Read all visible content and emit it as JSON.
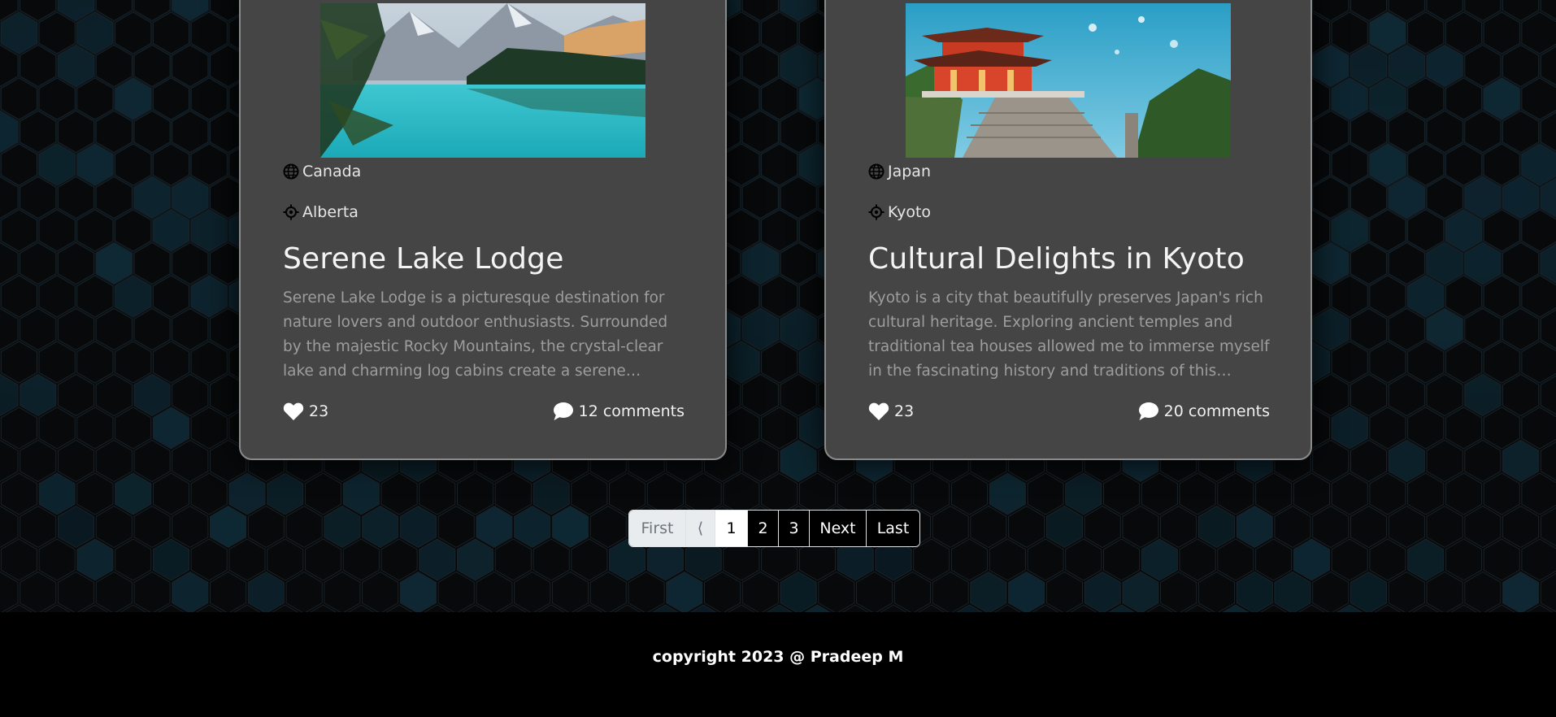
{
  "cards": [
    {
      "image_alt": "mountain lake with turquoise water",
      "country": "Canada",
      "region": "Alberta",
      "title": "Serene Lake Lodge",
      "description": "Serene Lake Lodge is a picturesque destination for nature lovers and outdoor enthusiasts. Surrounded by the majestic Rocky Mountains, the crystal-clear lake and charming log cabins create a serene atmosphere. I spent...",
      "likes": "23",
      "comments": "12 comments"
    },
    {
      "image_alt": "red Japanese temple among trees",
      "country": "Japan",
      "region": "Kyoto",
      "title": "Cultural Delights in Kyoto",
      "description": "Kyoto is a city that beautifully preserves Japan's rich cultural heritage. Exploring ancient temples and traditional tea houses allowed me to immerse myself in the fascinating history and traditions of this enchanting...",
      "likes": "23",
      "comments": "20 comments"
    }
  ],
  "pagination": {
    "first": "First",
    "prev": "⟨",
    "pages": [
      "1",
      "2",
      "3"
    ],
    "active_page": "1",
    "next": "Next",
    "last": "Last"
  },
  "footer": {
    "copyright": "copyright 2023 @ Pradeep M"
  },
  "colors": {
    "card_bg": "#454545",
    "card_border": "#8a8a8a",
    "page_bg": "#000000",
    "hex_tint": "#0f2a36"
  }
}
